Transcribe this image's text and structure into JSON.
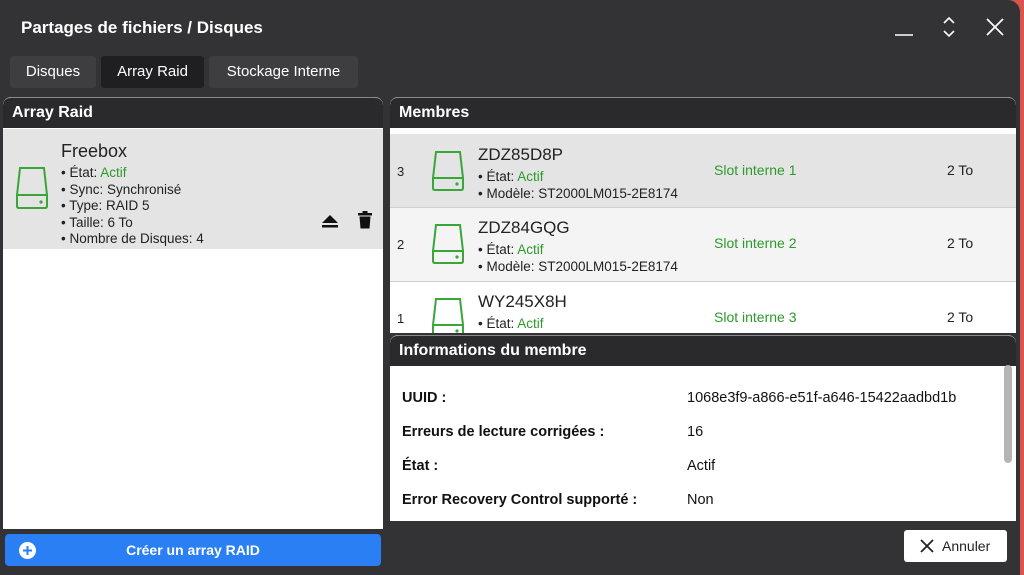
{
  "window": {
    "title": "Partages de fichiers / Disques"
  },
  "tabs": [
    {
      "label": "Disques"
    },
    {
      "label": "Array Raid"
    },
    {
      "label": "Stockage Interne"
    }
  ],
  "left_panel": {
    "title": "Array Raid",
    "raid": {
      "name": "Freebox",
      "state_label": "• État: ",
      "state_value": "Actif",
      "sync": "• Sync: Synchronisé",
      "type": "• Type: RAID 5",
      "size": "• Taille: 6 To",
      "disks": "• Nombre de Disques: 4"
    },
    "create_button": "Créer un array RAID"
  },
  "members_panel": {
    "title": "Membres",
    "state_label": "• État: ",
    "model_label": "• Modèle: ",
    "members": [
      {
        "index": "3",
        "serial": "ZDZ85D8P",
        "state": "Actif",
        "model": "ST2000LM015-2E8174",
        "slot": "Slot interne 1",
        "size": "2 To"
      },
      {
        "index": "2",
        "serial": "ZDZ84GQG",
        "state": "Actif",
        "model": "ST2000LM015-2E8174",
        "slot": "Slot interne 2",
        "size": "2 To"
      },
      {
        "index": "1",
        "serial": "WY245X8H",
        "state": "Actif",
        "model": "",
        "slot": "Slot interne 3",
        "size": "2 To"
      }
    ]
  },
  "info_panel": {
    "title": "Informations du membre",
    "rows": [
      {
        "label": "UUID :",
        "value": "1068e3f9-a866-e51f-a646-15422aadbd1b"
      },
      {
        "label": "Erreurs de lecture corrigées :",
        "value": "16"
      },
      {
        "label": "État :",
        "value": "Actif"
      },
      {
        "label": "Error Recovery Control supporté :",
        "value": "Non"
      }
    ]
  },
  "footer": {
    "cancel_label": "Annuler"
  },
  "colors": {
    "accent": "#2a7ff5",
    "status_green": "#2b9a2b",
    "window_bg": "#333335",
    "backdrop": "#d9534f"
  }
}
